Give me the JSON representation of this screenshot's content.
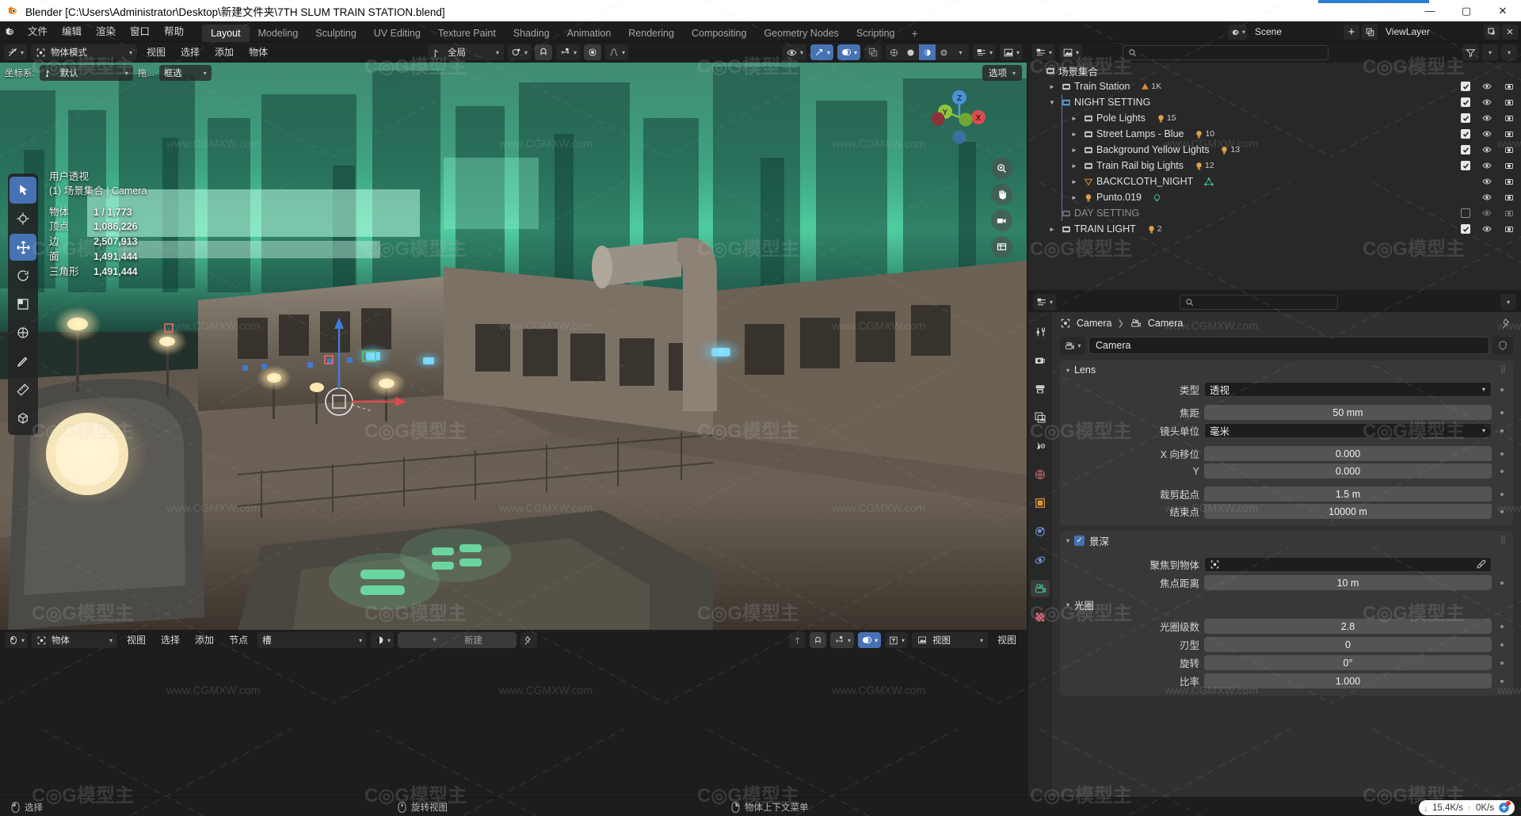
{
  "window": {
    "title": "Blender [C:\\Users\\Administrator\\Desktop\\新建文件夹\\7TH SLUM TRAIN STATION.blend]",
    "minimize": "—",
    "maximize": "▢",
    "close": "✕"
  },
  "menu": {
    "items": [
      "文件",
      "编辑",
      "渲染",
      "窗口",
      "帮助"
    ]
  },
  "workspace_tabs": [
    {
      "label": "Layout",
      "active": true
    },
    {
      "label": "Modeling",
      "active": false
    },
    {
      "label": "Sculpting",
      "active": false
    },
    {
      "label": "UV Editing",
      "active": false
    },
    {
      "label": "Texture Paint",
      "active": false
    },
    {
      "label": "Shading",
      "active": false
    },
    {
      "label": "Animation",
      "active": false
    },
    {
      "label": "Rendering",
      "active": false
    },
    {
      "label": "Compositing",
      "active": false
    },
    {
      "label": "Geometry Nodes",
      "active": false
    },
    {
      "label": "Scripting",
      "active": false
    },
    {
      "label": "+",
      "active": false
    }
  ],
  "topbar_right": {
    "scene": "Scene",
    "view_layer": "ViewLayer"
  },
  "viewport_header": {
    "mode": "物体模式",
    "menus": [
      "视图",
      "选择",
      "添加",
      "物体"
    ],
    "transform_orientation": "全局",
    "snap_label": "",
    "proportional": ""
  },
  "viewport_tool_header": {
    "orientation_label": "坐标系:",
    "orientation_value": "默认",
    "drag_label": "拖...",
    "drag_value": "框选",
    "options": "选项"
  },
  "viewport_stats": {
    "view_name": "用户透视",
    "collection_line": "(1) 场景集合 | Camera",
    "rows": [
      {
        "key": "物体",
        "value": "1 / 1,773"
      },
      {
        "key": "顶点",
        "value": "1,086,226"
      },
      {
        "key": "边",
        "value": "2,507,913"
      },
      {
        "key": "面",
        "value": "1,491,444"
      },
      {
        "key": "三角形",
        "value": "1,491,444"
      }
    ]
  },
  "gizmo_axes": [
    "Z",
    "Y",
    "X"
  ],
  "viewport_footer": {
    "editor_label": "物体",
    "menus": [
      "视图",
      "选择",
      "添加",
      "节点"
    ],
    "slot_label": "槽",
    "new_label": "新建",
    "plus": "+",
    "right_view_a": "视图",
    "right_view_b": "视图"
  },
  "statusbar": {
    "items": [
      {
        "icon": "mouse-left-icon",
        "label": "选择"
      },
      {
        "icon": "mouse-mid-icon",
        "label": "旋转视图"
      },
      {
        "icon": "mouse-right-icon",
        "label": "物体上下文菜单"
      }
    ],
    "network": {
      "down": "15.4K/s",
      "up": "0K/s",
      "down_arrow": "↓",
      "up_arrow": "↑"
    }
  },
  "outliner": {
    "scene_collection": "场景集合",
    "rows": [
      {
        "name": "Train Station",
        "indent": 1,
        "icon": "collection-icon",
        "expander": "►",
        "badge": "1K",
        "badge_icon": "mesh-data-icon",
        "check": true,
        "eye": true,
        "camera": true,
        "dim": false
      },
      {
        "name": "NIGHT SETTING",
        "indent": 1,
        "icon": "collection-icon-active",
        "expander": "▼",
        "badge": "",
        "badge_icon": "",
        "check": true,
        "eye": true,
        "camera": true,
        "dim": false
      },
      {
        "name": "Pole Lights",
        "indent": 2,
        "icon": "collection-icon",
        "expander": "►",
        "badge": "15",
        "badge_icon": "light-icon",
        "check": true,
        "eye": true,
        "camera": true,
        "dim": false
      },
      {
        "name": "Street Lamps - Blue",
        "indent": 2,
        "icon": "collection-icon",
        "expander": "►",
        "badge": "10",
        "badge_icon": "light-icon",
        "check": true,
        "eye": true,
        "camera": true,
        "dim": false
      },
      {
        "name": "Background Yellow Lights",
        "indent": 2,
        "icon": "collection-icon",
        "expander": "►",
        "badge": "13",
        "badge_icon": "light-icon",
        "check": true,
        "eye": true,
        "camera": true,
        "dim": false
      },
      {
        "name": "Train Rail big Lights",
        "indent": 2,
        "icon": "collection-icon",
        "expander": "►",
        "badge": "12",
        "badge_icon": "light-icon",
        "check": true,
        "eye": true,
        "camera": true,
        "dim": false
      },
      {
        "name": "BACKCLOTH_NIGHT",
        "indent": 2,
        "icon": "mesh-object-icon",
        "expander": "►",
        "badge": "",
        "badge_icon": "mesh-data-icon",
        "check": false,
        "eye": true,
        "camera": true,
        "dim": false
      },
      {
        "name": "Punto.019",
        "indent": 2,
        "icon": "light-object-icon",
        "expander": "►",
        "badge": "",
        "badge_icon": "light-data-icon",
        "check": false,
        "eye": true,
        "camera": true,
        "dim": false
      },
      {
        "name": "DAY SETTING",
        "indent": 1,
        "icon": "collection-icon-dim",
        "expander": "",
        "badge": "",
        "badge_icon": "",
        "check": "empty",
        "eye": true,
        "camera": true,
        "dim": true
      },
      {
        "name": "TRAIN LIGHT",
        "indent": 1,
        "icon": "collection-icon",
        "expander": "►",
        "badge": "2",
        "badge_icon": "light-icon",
        "check": true,
        "eye": true,
        "camera": true,
        "dim": false
      }
    ]
  },
  "properties": {
    "breadcrumb": [
      {
        "label": "Camera",
        "icon": "object-icon"
      },
      {
        "label": "Camera",
        "icon": "camera-data-icon"
      }
    ],
    "id_name": "Camera",
    "lens_panel": {
      "title": "Lens",
      "rows": [
        {
          "label": "类型",
          "value": "透视",
          "type": "dropdown"
        },
        {
          "label": "焦距",
          "value": "50 mm",
          "type": "value"
        },
        {
          "label": "镜头单位",
          "value": "毫米",
          "type": "dropdown"
        },
        {
          "label": "X 向移位",
          "value": "0.000",
          "type": "value"
        },
        {
          "label": "Y",
          "value": "0.000",
          "type": "value"
        },
        {
          "label": "裁剪起点",
          "value": "1.5 m",
          "type": "value"
        },
        {
          "label": "结束点",
          "value": "10000 m",
          "type": "value"
        }
      ]
    },
    "dof_panel": {
      "title": "景深",
      "enabled": true,
      "rows": [
        {
          "label": "聚焦到物体",
          "value": "",
          "type": "object-field"
        },
        {
          "label": "焦点距离",
          "value": "10 m",
          "type": "value"
        }
      ]
    },
    "aperture_panel": {
      "title": "光圈",
      "rows": [
        {
          "label": "光圈级数",
          "value": "2.8",
          "type": "value"
        },
        {
          "label": "刃型",
          "value": "0",
          "type": "value"
        },
        {
          "label": "旋转",
          "value": "0°",
          "type": "value"
        },
        {
          "label": "比率",
          "value": "1.000",
          "type": "value"
        }
      ]
    },
    "nav_icons": [
      "tool-icon",
      "render-icon",
      "output-icon",
      "viewlayer-icon",
      "scene-icon",
      "world-icon",
      "object-icon",
      "modifier-icon",
      "physics-icon",
      "camera-data-icon",
      "texture-icon"
    ]
  },
  "colors": {
    "accent_blue": "#4772b3",
    "header_bg": "#1d1d1d",
    "panel_bg": "#303030",
    "outliner_bg": "#282828",
    "field_bg": "#545454",
    "text": "#e6e6e6"
  }
}
